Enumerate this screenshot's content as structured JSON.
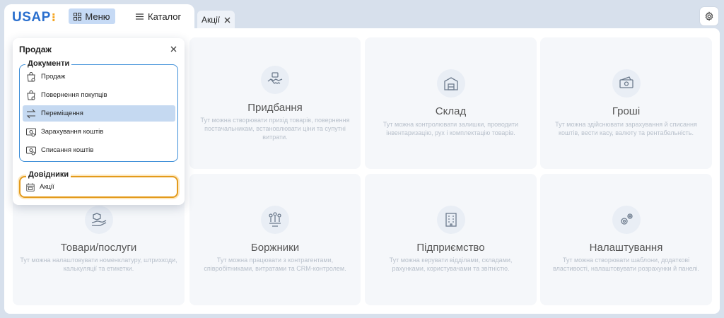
{
  "header": {
    "logo": "USAP",
    "logo_dots": "⁝",
    "menu_label": "Меню",
    "catalog_label": "Каталог",
    "tab_label": "Акції"
  },
  "cards": [
    {
      "title": "Придбання",
      "desc": "Тут можна створювати прихід товарів, повернення постачальникам, встановлювати ціни та супутні витрати."
    },
    {
      "title": "Склад",
      "desc": "Тут можна контролювати залишки, проводити інвентаризацію, рух і комплектацію товарів."
    },
    {
      "title": "Гроші",
      "desc": "Тут можна здійснювати зарахування й списання коштів, вести касу, валюту та рентабельність."
    },
    {
      "title": "Товари/послуги",
      "desc": "Тут можна налаштовувати номенклатуру, штрихкоди, калькуляції та етикетки."
    },
    {
      "title": "Боржники",
      "desc": "Тут можна працювати з контрагентами, співробітниками, витратами та CRM-контролем."
    },
    {
      "title": "Підприємство",
      "desc": "Тут можна керувати відділами, складами, рахунками, користувачами та звітністю."
    },
    {
      "title": "Налаштування",
      "desc": "Тут можна створювати шаблони, додаткові властивості, налаштовувати розрахунки й панелі."
    }
  ],
  "popup": {
    "title": "Продаж",
    "docs_label": "Документи",
    "docs": [
      "Продаж",
      "Повернення покупців",
      "Переміщення",
      "Зарахування коштів",
      "Списання коштів"
    ],
    "refs_label": "Довідники",
    "refs": [
      "Акції"
    ],
    "active_doc": "Переміщення"
  },
  "colors": {
    "accent": "#2a6fce",
    "active_bg": "#c5d9f1",
    "group_border": "#3d8ed8",
    "highlight": "#e39a1b"
  }
}
